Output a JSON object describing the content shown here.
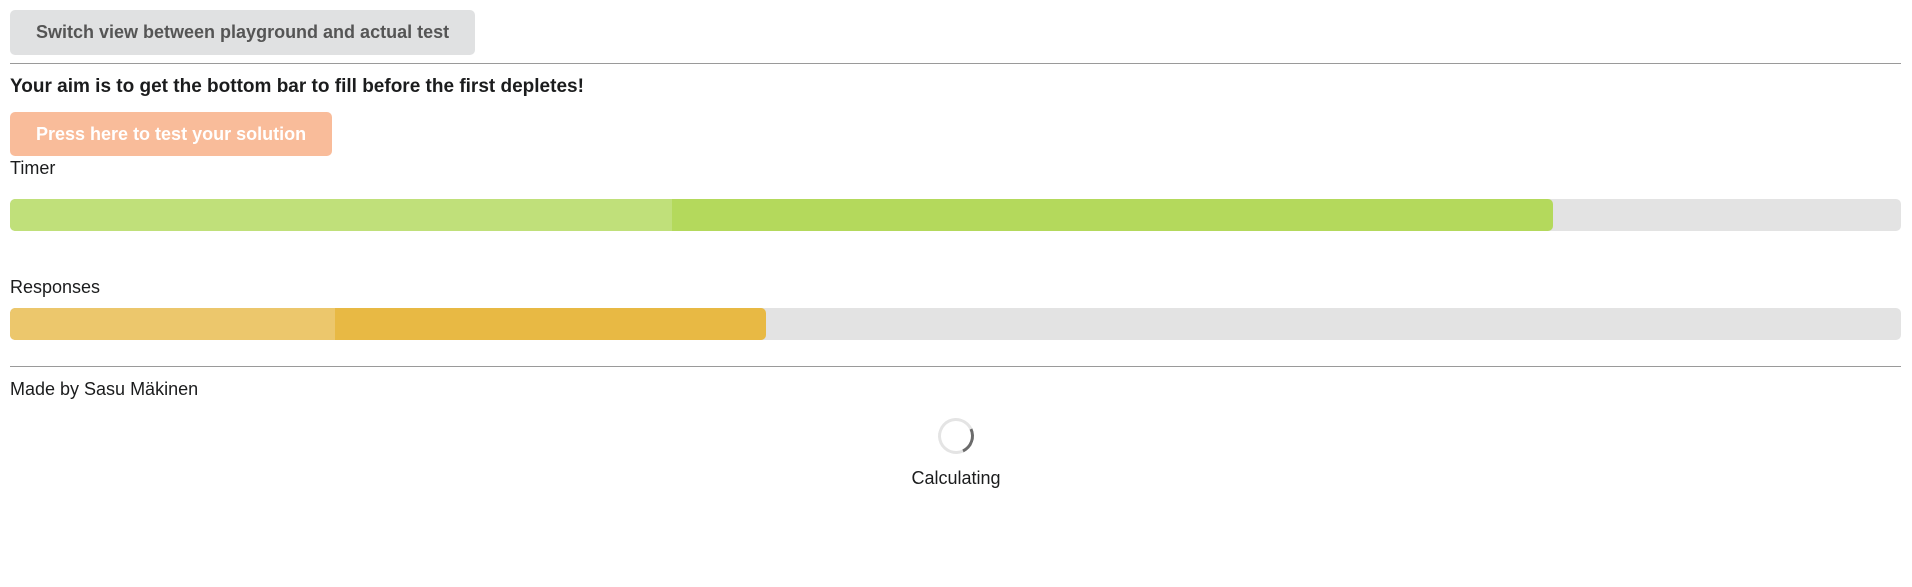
{
  "toolbar": {
    "switch_label": "Switch view between playground and actual test"
  },
  "instructions": {
    "aim": "Your aim is to get the bottom bar to fill before the first depletes!"
  },
  "actions": {
    "test_label": "Press here to test your solution",
    "test_color": "#f9bc9a"
  },
  "timer": {
    "label": "Timer",
    "buffer_percent": 35,
    "fill_percent": 81.6,
    "buffer_color": "#c0e07a",
    "fill_color": "#b4d95c"
  },
  "responses": {
    "label": "Responses",
    "buffer_percent": 17.2,
    "fill_percent": 40,
    "buffer_color": "#ecc76c",
    "fill_color": "#e8b944"
  },
  "footer": {
    "made_by": "Made by Sasu Mäkinen"
  },
  "status": {
    "loading_text": "Calculating",
    "icon": "spinner-icon"
  }
}
